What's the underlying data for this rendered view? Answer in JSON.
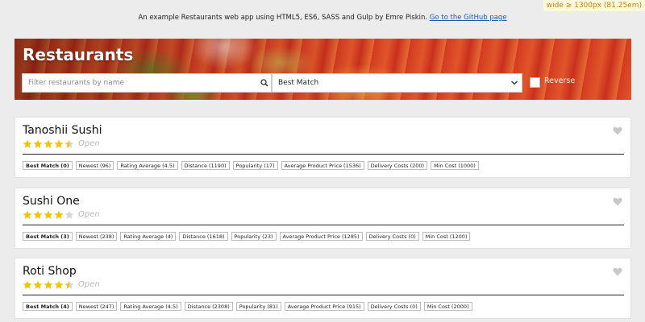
{
  "breakpoint_badge": "wide ≥ 1300px (81.25em)",
  "intro": {
    "text": "An example Restaurants web app using HTML5, ES6, SASS and Gulp by Emre Piskin. ",
    "link_label": "Go to the GitHub page"
  },
  "header": {
    "title": "Restaurants",
    "filter_placeholder": "Filter restaurants by name",
    "filter_value": "",
    "sort_selected": "Best Match",
    "reverse_label": "Reverse",
    "reverse_checked": false
  },
  "colors": {
    "star": "#f2c200",
    "star_empty": "#d6d6d6",
    "heart": "#c8c8c8"
  },
  "restaurants": [
    {
      "name": "Tanoshii Sushi",
      "rating": 4.5,
      "status": "Open",
      "chips": [
        "Best Match (0)",
        "Newest (96)",
        "Rating Average (4.5)",
        "Distance (1190)",
        "Popularity (17)",
        "Average Product Price (1536)",
        "Delivery Costs (200)",
        "Min Cost (1000)"
      ]
    },
    {
      "name": "Sushi One",
      "rating": 4,
      "status": "Open",
      "chips": [
        "Best Match (3)",
        "Newest (238)",
        "Rating Average (4)",
        "Distance (1618)",
        "Popularity (23)",
        "Average Product Price (1285)",
        "Delivery Costs (0)",
        "Min Cost (1200)"
      ]
    },
    {
      "name": "Roti Shop",
      "rating": 4.5,
      "status": "Open",
      "chips": [
        "Best Match (4)",
        "Newest (247)",
        "Rating Average (4.5)",
        "Distance (2308)",
        "Popularity (81)",
        "Average Product Price (915)",
        "Delivery Costs (0)",
        "Min Cost (2000)"
      ]
    }
  ]
}
